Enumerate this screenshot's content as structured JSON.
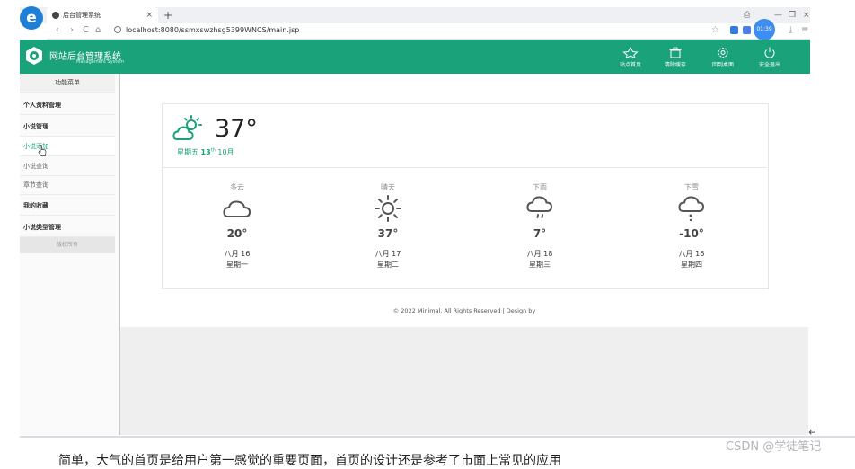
{
  "browser": {
    "tab_title": "后台管理系统",
    "tab_close": "×",
    "new_tab": "+",
    "url": "localhost:8080/ssmxswzhsg5399WNCS/main.jsp",
    "timer": "01:39",
    "nav": [
      "‹",
      "›",
      "C",
      "⌂"
    ],
    "window_controls": [
      "—",
      "❐",
      "×"
    ]
  },
  "app": {
    "title": "网站后台管理系统",
    "subtitle": "Management System",
    "header_buttons": [
      {
        "label": "站点首页",
        "icon": "star-icon"
      },
      {
        "label": "清除缓存",
        "icon": "trash-icon"
      },
      {
        "label": "回到桌面",
        "icon": "gear-icon"
      },
      {
        "label": "安全退出",
        "icon": "power-icon"
      }
    ],
    "accent": "#1aa27a"
  },
  "sidebar": {
    "header": "功能菜单",
    "items": [
      {
        "label": "个人资料管理",
        "kind": "group"
      },
      {
        "label": "小说管理",
        "kind": "group"
      },
      {
        "label": "小说添加",
        "kind": "active"
      },
      {
        "label": "小说查询",
        "kind": "sub"
      },
      {
        "label": "章节查询",
        "kind": "sub"
      },
      {
        "label": "我的收藏",
        "kind": "group"
      },
      {
        "label": "小说类型管理",
        "kind": "group"
      }
    ],
    "copyright": "版权所有"
  },
  "weather": {
    "current_temp": "37°",
    "weekday": "星期五",
    "day": "13",
    "day_suffix": "th",
    "month": "10月",
    "forecast": [
      {
        "condition": "多云",
        "icon": "cloud-icon",
        "temp": "20°",
        "date": "八月 16",
        "weekday": "星期一"
      },
      {
        "condition": "晴天",
        "icon": "sun-icon",
        "temp": "37°",
        "date": "八月 17",
        "weekday": "星期二"
      },
      {
        "condition": "下雨",
        "icon": "rain-icon",
        "temp": "7°",
        "date": "八月 18",
        "weekday": "星期三"
      },
      {
        "condition": "下雪",
        "icon": "snow-icon",
        "temp": "-10°",
        "date": "八月 16",
        "weekday": "星期四"
      }
    ]
  },
  "footer": "© 2022 Minimal. All Rights Reserved | Design by",
  "document": {
    "text": "简单，大气的首页是给用户第一感觉的重要页面，首页的设计还是参考了市面上常见的应用",
    "watermark": "CSDN @学徒笔记"
  }
}
